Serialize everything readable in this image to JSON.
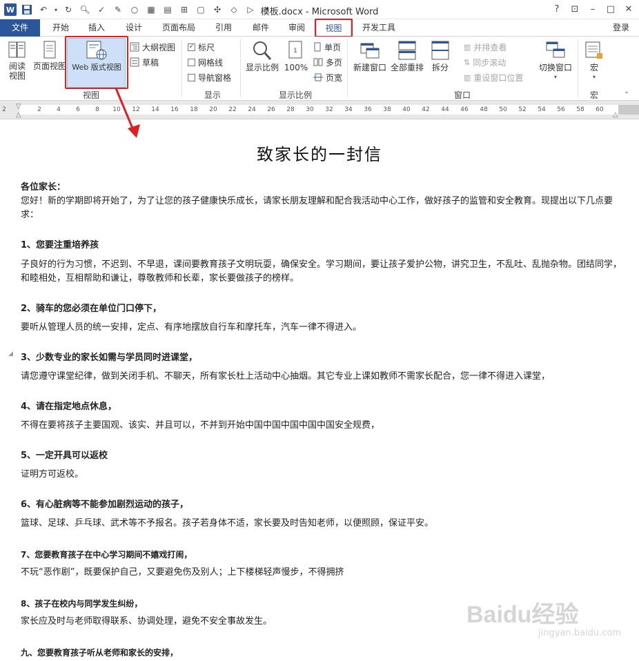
{
  "window": {
    "title": "模板.docx - Microsoft Word",
    "help": "?",
    "controls": [
      "?",
      "⊡",
      "–",
      "□",
      "✕"
    ]
  },
  "tabs": [
    {
      "label": "文件"
    },
    {
      "label": "开始"
    },
    {
      "label": "插入"
    },
    {
      "label": "设计"
    },
    {
      "label": "页面布局"
    },
    {
      "label": "引用"
    },
    {
      "label": "邮件"
    },
    {
      "label": "审阅"
    },
    {
      "label": "视图"
    },
    {
      "label": "开发工具"
    }
  ],
  "login": "登录",
  "ribbon": {
    "view_group": {
      "label": "视图",
      "read_mode": "阅读\n视图",
      "print_layout": "页面视图",
      "web_layout": "Web 版式视图",
      "outline": "大纲视图",
      "draft": "草稿"
    },
    "show_group": {
      "label": "显示",
      "ruler": "标尺",
      "gridlines": "网格线",
      "nav_pane": "导航窗格",
      "ruler_checked": true
    },
    "zoom_group": {
      "label": "显示比例",
      "zoom": "显示比例",
      "hundred": "100%",
      "one_page": "单页",
      "multi_page": "多页",
      "page_width": "页宽"
    },
    "window_group": {
      "label": "窗口",
      "new_window": "新建窗口",
      "arrange_all": "全部重排",
      "split": "拆分",
      "side_by_side": "并排查看",
      "sync_scroll": "同步滚动",
      "reset_pos": "重设窗口位置",
      "switch_windows": "切换窗口"
    },
    "macro_group": {
      "label": "宏",
      "macros": "宏"
    }
  },
  "ruler_ticks": [
    "2",
    "2",
    "4",
    "6",
    "8",
    "10",
    "12",
    "14",
    "16",
    "18",
    "20",
    "22",
    "24",
    "26",
    "28",
    "30",
    "32",
    "34",
    "36",
    "38",
    "40",
    "42",
    "44",
    "46",
    "48",
    "50",
    "52",
    "54",
    "56",
    "58",
    "60"
  ],
  "document": {
    "title": "致家长的一封信",
    "greeting": "各位家长：",
    "intro": "您好！新的学期即将开始了，为了让您的孩子健康快乐成长，请家长朋友理解和配合我活动中心工作，做好孩子的监管和安全教育。现提出以下几点要求：",
    "sections": [
      {
        "heading": "1、您要注重培养孩",
        "body": "子良好的行为习惯，不迟到、不早退，课间要教育孩子文明玩耍，确保安全。学习期间，要让孩子爱护公物，讲究卫生，不乱吐、乱抛杂物。团结同学，和睦相处，互相帮助和谦让，尊敬教师和长辈，家长要做孩子的榜样。"
      },
      {
        "heading": "2、骑车的您必须在单位门口停下，",
        "body": "要听从管理人员的统一安排，定点、有序地摆放自行车和摩托车，汽车一律不得进入。"
      },
      {
        "heading": "3、少数专业的家长如需与学员同时进课堂，",
        "body": "请您遵守课堂纪律，做到关闭手机、不聊天，所有家长杜上活动中心抽烟。其它专业上课如教师不需家长配合，您一律不得进入课堂，"
      },
      {
        "heading": "4、请在指定地点休息，",
        "body": "不得在要将孩子主要国观、该实、并且可以，不并到开始中国中国中国中国中国安全规费，"
      },
      {
        "heading": "5、一定开具可以返校",
        "body": "证明方可返校。"
      },
      {
        "heading": "6、有心脏病等不能参加剧烈运动的孩子，",
        "body": "篮球、足球、乒乓球、武术等不予报名。孩子若身体不适，家长要及时告知老师，以便照顾，保证平安。"
      },
      {
        "heading": "7、您要教育孩子在中心学习期间不嬉戏打闹，",
        "body": "不玩“恶作剧”，既要保护自己，又要避免伤及别人；上下楼梯轻声慢步，不得拥挤"
      },
      {
        "heading": "8、孩子在校内与同学发生纠纷，",
        "body": "家长应及时与老师取得联系、协调处理，避免不安全事故发生。"
      },
      {
        "heading": "九、您要教育孩子听从老师和家长的安排，",
        "body": ""
      }
    ]
  },
  "watermark": {
    "brand": "Baidu经验",
    "url": "jingyan.baidu.com"
  },
  "colors": {
    "accent": "#2b579a",
    "highlight": "#e02020",
    "selected_bg": "#cde0f7"
  }
}
